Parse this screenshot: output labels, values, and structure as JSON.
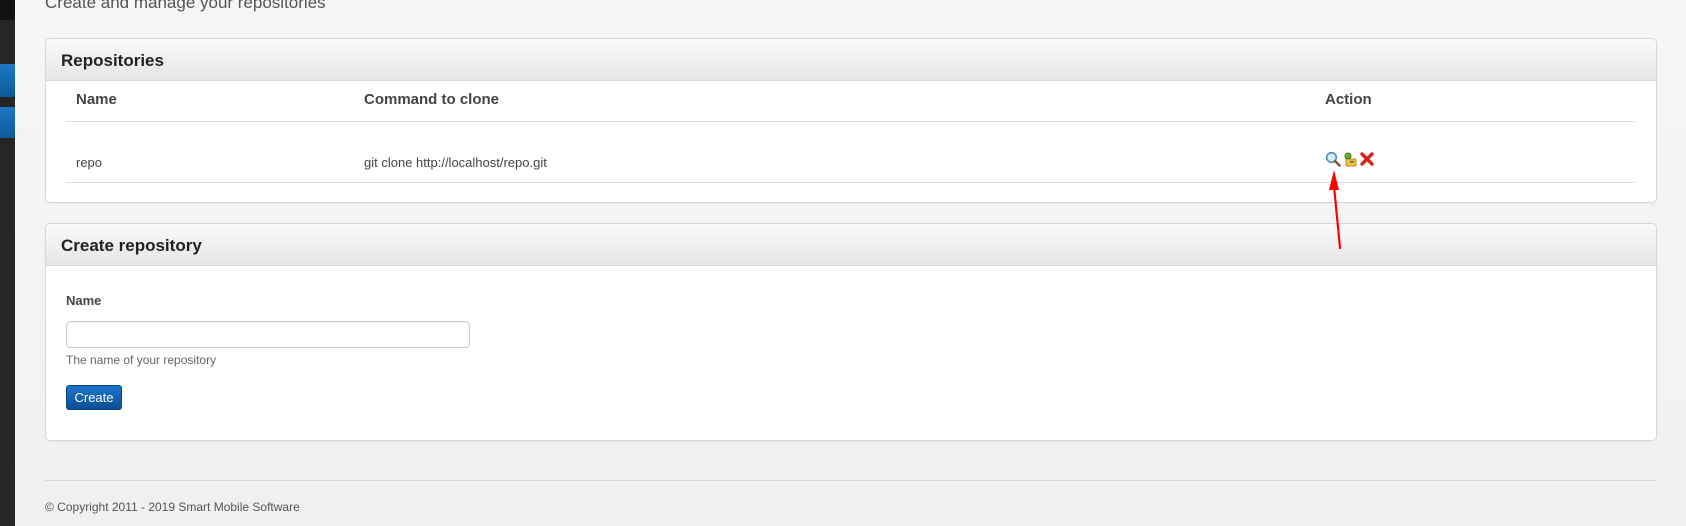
{
  "page": {
    "subtitle": "Create and manage your repositories"
  },
  "repositories": {
    "title": "Repositories",
    "columns": [
      "Name",
      "Command to clone",
      "Action"
    ],
    "rows": [
      {
        "name": "repo",
        "clone_command": "git clone http://localhost/repo.git"
      }
    ],
    "actions": [
      "view-icon",
      "edit-icon",
      "delete-icon"
    ]
  },
  "create": {
    "title": "Create repository",
    "name_label": "Name",
    "name_value": "",
    "name_placeholder": "",
    "help_text": "The name of your repository",
    "button_label": "Create"
  },
  "footer": {
    "copyright": "© Copyright 2011 - 2019 Smart Mobile Software"
  },
  "colors": {
    "primary_button": "#0b4f96",
    "delete_icon": "#d9231d",
    "annotation_arrow": "#ff0000"
  }
}
